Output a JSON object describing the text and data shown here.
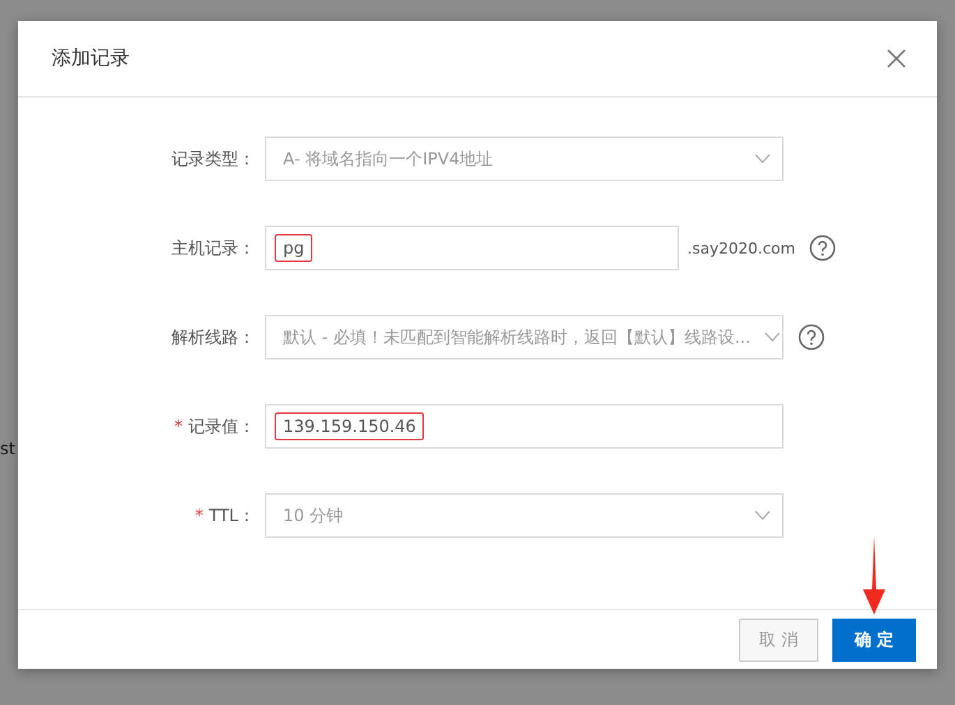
{
  "background_page": {
    "link_text": "st"
  },
  "dialog": {
    "title": "添加记录",
    "fields": [
      {
        "kind": "select",
        "label": "记录类型：",
        "value": "A- 将域名指向一个IPV4地址",
        "help": false,
        "highlighted": false
      },
      {
        "kind": "input",
        "label": "主机记录：",
        "value": "pg",
        "suffix": ".say2020.com",
        "help": true,
        "highlighted": true
      },
      {
        "kind": "select",
        "label": "解析线路：",
        "value": "默认 - 必填！未匹配到智能解析线路时，返回【默认】线路设...",
        "help": true,
        "highlighted": false
      },
      {
        "kind": "input",
        "required_mark": "*",
        "label": "记录值：",
        "value": "139.159.150.46",
        "help": false,
        "highlighted": true
      },
      {
        "kind": "select",
        "required_mark": "*",
        "label": "TTL：",
        "value": "10 分钟",
        "help": false,
        "highlighted": false
      }
    ],
    "buttons": [
      {
        "label": "取 消",
        "kind": "secondary"
      },
      {
        "label": "确 定",
        "kind": "primary",
        "pointed_at": true
      }
    ]
  }
}
